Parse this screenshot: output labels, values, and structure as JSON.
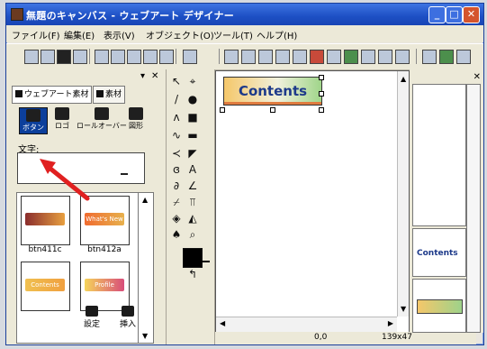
{
  "window": {
    "title": "無題のキャンバス - ウェブアート デザイナー"
  },
  "menubar": {
    "items": [
      {
        "label": "ファイル(F)"
      },
      {
        "label": "編集(E)"
      },
      {
        "label": "表示(V)"
      },
      {
        "label": "オブジェクト(O)"
      },
      {
        "label": "ツール(T)"
      },
      {
        "label": "ヘルプ(H)"
      }
    ]
  },
  "left_panel": {
    "tabs": [
      {
        "label": "ウェブアート素材"
      },
      {
        "label": "素材"
      }
    ],
    "tools": [
      {
        "label": "ボタン"
      },
      {
        "label": "ロゴ"
      },
      {
        "label": "ロールオーバー"
      },
      {
        "label": "図形"
      }
    ],
    "text_label": "文字:",
    "thumbnails": [
      {
        "label": "btn411c",
        "pill": "",
        "colors": [
          "#8a2d2d",
          "#e8a040"
        ]
      },
      {
        "label": "btn412a",
        "pill": "What's New",
        "colors": [
          "#f06b2f",
          "#e7b14d"
        ]
      },
      {
        "label": "",
        "pill": "Contents",
        "colors": [
          "#f0c050",
          "#f0a040"
        ]
      },
      {
        "label": "",
        "pill": "Profile",
        "colors": [
          "#f5d45a",
          "#d84d7a"
        ]
      }
    ],
    "bottom_tools": [
      {
        "label": "設定"
      },
      {
        "label": "挿入"
      }
    ]
  },
  "canvas": {
    "button_text": "Contents"
  },
  "status": {
    "position": "0,0",
    "size": "139x47"
  },
  "right_panel": {
    "preview_label": "Contents"
  }
}
